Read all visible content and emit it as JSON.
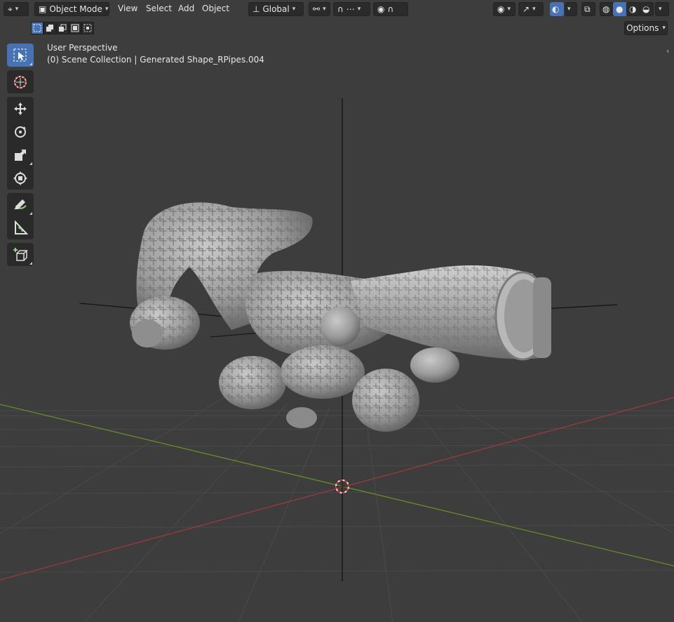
{
  "header": {
    "mode": "Object Mode",
    "menus": [
      "View",
      "Select",
      "Add",
      "Object"
    ],
    "orientation": "Global",
    "options_label": "Options"
  },
  "viewport": {
    "perspective": "User Perspective",
    "collection_info": "(0) Scene Collection | Generated Shape_RPipes.004"
  },
  "toolbar": {
    "tools": [
      "select-box",
      "cursor",
      "move",
      "rotate",
      "scale",
      "transform",
      "annotate",
      "measure",
      "add-cube"
    ],
    "active_tool": "select-box"
  },
  "colors": {
    "viewport_bg": "#3d3d3d",
    "grid_line": "#4a4a4a",
    "x_axis": "#9a3a3a",
    "y_axis": "#6a8a2a",
    "accent": "#4772b3",
    "mesh": "#9c9c9c"
  }
}
